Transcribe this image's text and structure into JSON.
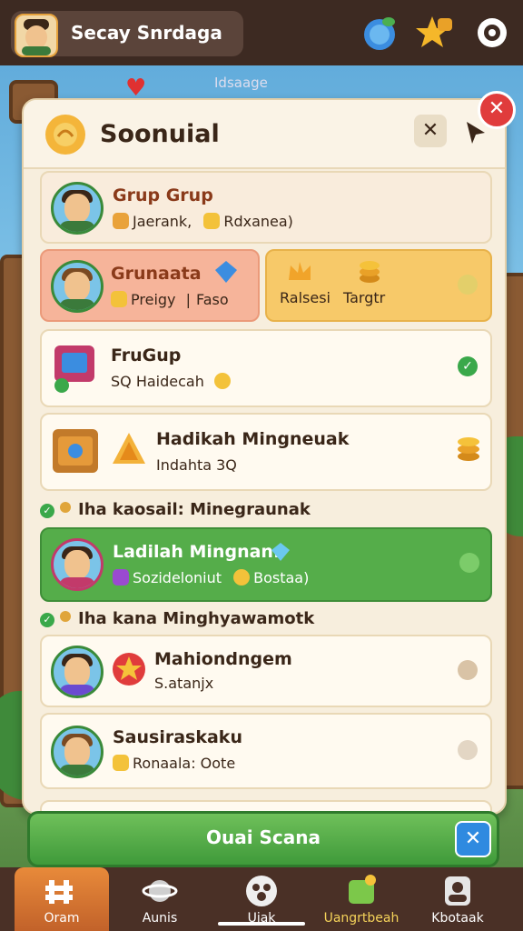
{
  "header": {
    "username": "Secay Snrdaga",
    "icons": [
      "planet-icon",
      "star-coin-icon",
      "settings-gear-icon"
    ],
    "status_text": "Idsaage"
  },
  "panel": {
    "title": "Soonuial",
    "close_label": "✕",
    "entries": [
      {
        "title": "Grup Grup",
        "sub_a": "Jaerank,",
        "sub_b": "Rdxanea)"
      },
      {
        "title": "Grunaata",
        "sub_a": "Preigy",
        "sep": "|",
        "sub_b": "Faso",
        "side_a": "Ralsesi",
        "side_b": "Targtr"
      },
      {
        "title": "FruGup",
        "sub_a": "SQ Haidecah"
      },
      {
        "title": "Hadikah Mingneuak",
        "sub_a": "Indahta 3Q"
      }
    ],
    "section_1": "Iha kaosail: Minegraunak",
    "highlight": {
      "title": "Ladilah Mingnan:",
      "sub_a": "Sozideloniut",
      "sub_b": "Bostaa)"
    },
    "section_2": "Iha kana Minghyawamotk",
    "entries_2": [
      {
        "title": "Mahiondngem",
        "sub_a": "S.atanjx"
      },
      {
        "title": "Sausiraskaku",
        "sub_a": "Ronaala: Ootе"
      }
    ]
  },
  "bottom_button": {
    "label": "Ouai Scana",
    "close_label": "✕"
  },
  "nav": [
    {
      "label": "Oram",
      "icon": "grid-icon",
      "active": true
    },
    {
      "label": "Aunis",
      "icon": "planet-icon"
    },
    {
      "label": "Uiak",
      "icon": "paw-icon"
    },
    {
      "label": "Uangrtbeah",
      "icon": "puzzle-icon"
    },
    {
      "label": "Kbotaak",
      "icon": "user-icon"
    }
  ],
  "colors": {
    "accent_green": "#4caf50",
    "highlight_peach": "#f6b49a",
    "highlight_yellow": "#f7c969"
  }
}
